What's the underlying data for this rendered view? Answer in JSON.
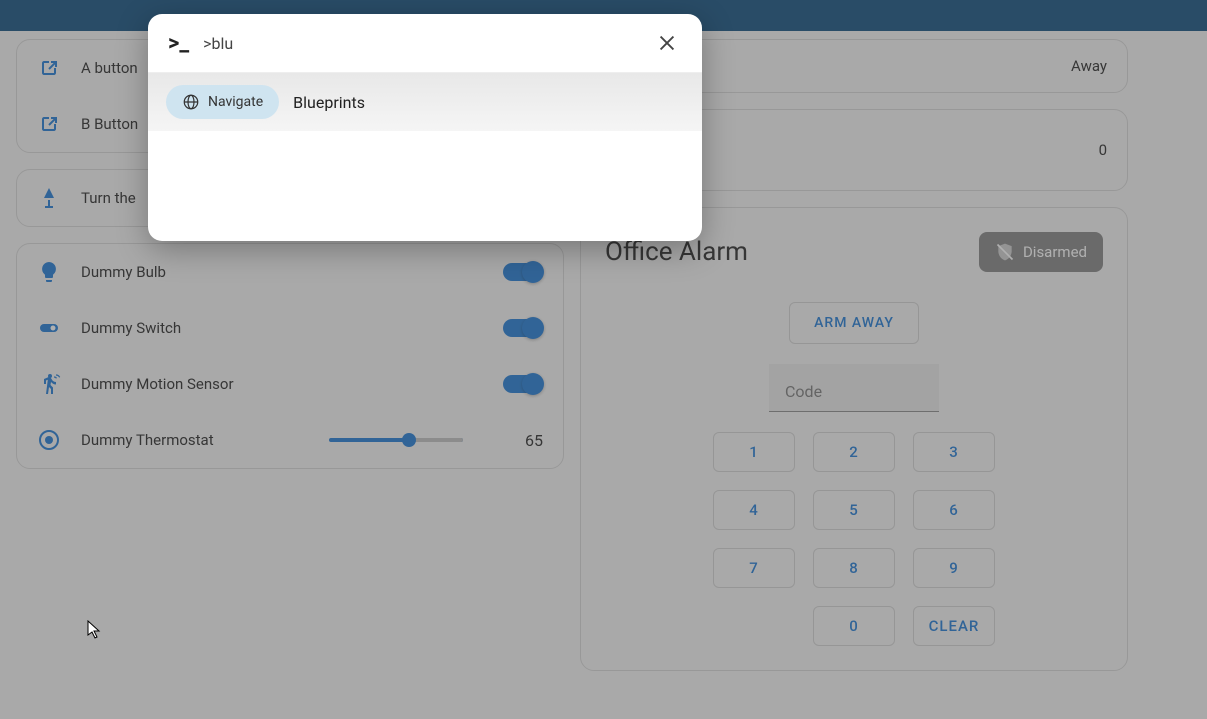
{
  "palette": {
    "query": ">blu",
    "chip": "Navigate",
    "result": "Blueprints"
  },
  "left": {
    "buttons": {
      "a": "A button",
      "b": "B Button"
    },
    "scene": "Turn the",
    "devices": {
      "bulb": "Dummy Bulb",
      "switch": "Dummy Switch",
      "motion": "Dummy Motion Sensor",
      "thermo": "Dummy Thermostat",
      "thermo_val": "65"
    }
  },
  "right": {
    "away": "Away",
    "counter": "0",
    "alarm": {
      "title": "Office Alarm",
      "state": "Disarmed",
      "arm": "ARM AWAY",
      "code_placeholder": "Code",
      "keys": [
        "1",
        "2",
        "3",
        "4",
        "5",
        "6",
        "7",
        "8",
        "9",
        "0",
        "CLEAR"
      ]
    }
  }
}
